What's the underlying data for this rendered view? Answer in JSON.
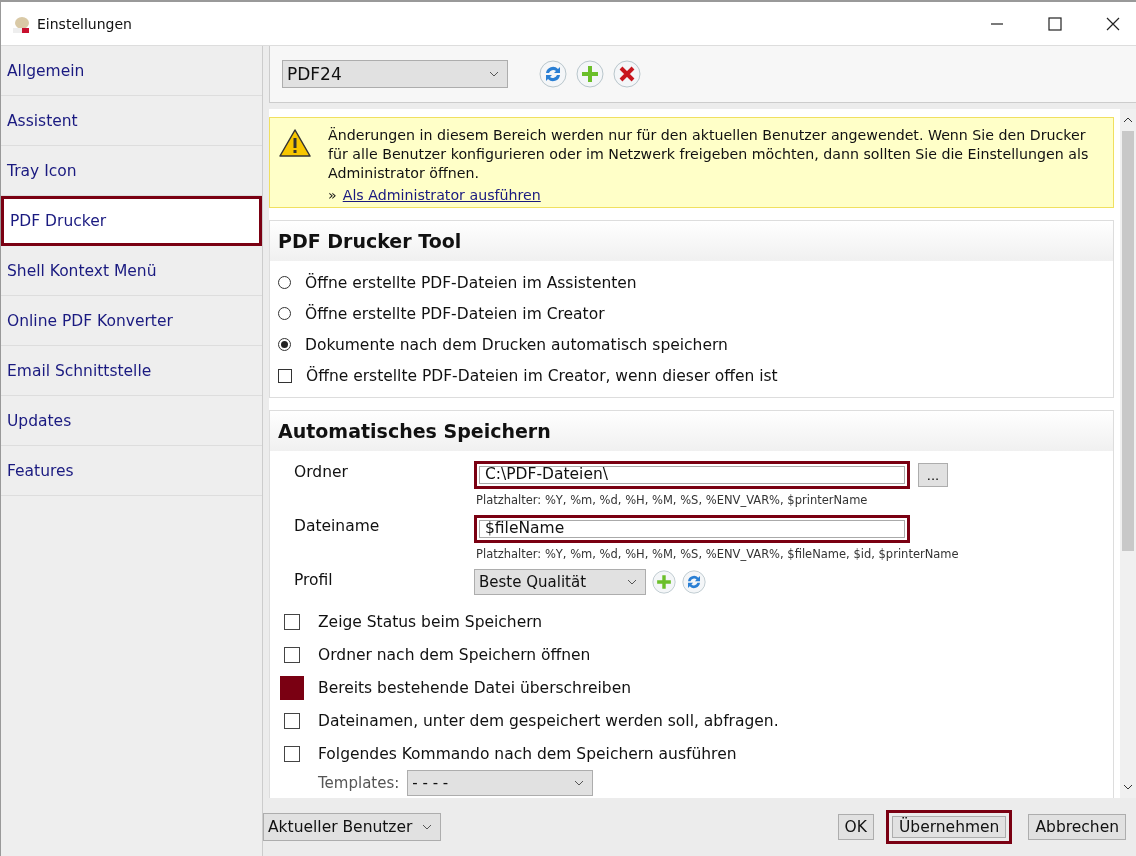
{
  "window": {
    "title": "Einstellungen"
  },
  "sidebar": {
    "items": [
      {
        "label": "Allgemein",
        "selected": false,
        "highlighted": false
      },
      {
        "label": "Assistent",
        "selected": false,
        "highlighted": false
      },
      {
        "label": "Tray Icon",
        "selected": false,
        "highlighted": false
      },
      {
        "label": "PDF Drucker",
        "selected": true,
        "highlighted": true
      },
      {
        "label": "Shell Kontext Menü",
        "selected": false,
        "highlighted": false
      },
      {
        "label": "Online PDF Konverter",
        "selected": false,
        "highlighted": false
      },
      {
        "label": "Email Schnittstelle",
        "selected": false,
        "highlighted": false
      },
      {
        "label": "Updates",
        "selected": false,
        "highlighted": false
      },
      {
        "label": "Features",
        "selected": false,
        "highlighted": false
      }
    ]
  },
  "toolbar": {
    "printer": "PDF24"
  },
  "notice": {
    "text": "Änderungen in diesem Bereich werden nur für den aktuellen Benutzer angewendet. Wenn Sie den Drucker für alle Benutzer konfigurieren oder im Netzwerk freigeben möchten, dann sollten Sie die Einstellungen als Administrator öffnen.",
    "link_prefix": "»",
    "link": "Als Administrator ausführen"
  },
  "printer_tool": {
    "title": "PDF Drucker Tool",
    "options": [
      {
        "kind": "radio",
        "label": "Öffne erstellte PDF-Dateien im Assistenten",
        "selected": false
      },
      {
        "kind": "radio",
        "label": "Öffne erstellte PDF-Dateien im Creator",
        "selected": false
      },
      {
        "kind": "radio",
        "label": "Dokumente nach dem Drucken automatisch speichern",
        "selected": true
      },
      {
        "kind": "checkbox",
        "label": "Öffne erstellte PDF-Dateien im Creator, wenn dieser offen ist",
        "checked": false
      }
    ]
  },
  "autosave": {
    "title": "Automatisches Speichern",
    "fields": [
      {
        "label": "Ordner",
        "value": "C:\\PDF-Dateien\\",
        "hint": "Platzhalter: %Y, %m, %d, %H, %M, %S, %ENV_VAR%, $printerName",
        "highlighted": true,
        "browse": "..."
      },
      {
        "label": "Dateiname",
        "value": "$fileName",
        "hint": "Platzhalter: %Y, %m, %d, %H, %M, %S, %ENV_VAR%, $fileName, $id, $printerName",
        "highlighted": true
      }
    ],
    "profile": {
      "label": "Profil",
      "value": "Beste Qualität"
    },
    "options": [
      {
        "label": "Zeige Status beim Speichern",
        "checked": false,
        "highlighted": false
      },
      {
        "label": "Ordner nach dem Speichern öffnen",
        "checked": false,
        "highlighted": false
      },
      {
        "label": "Bereits bestehende Datei überschreiben",
        "checked": true,
        "highlighted": true
      },
      {
        "label": "Dateinamen, unter dem gespeichert werden soll, abfragen.",
        "checked": false,
        "highlighted": false
      },
      {
        "label": "Folgendes Kommando nach dem Speichern ausführen",
        "checked": false,
        "highlighted": false
      }
    ],
    "templates": {
      "label": "Templates:",
      "value": "- - - -"
    }
  },
  "footer": {
    "scope": "Aktueller Benutzer",
    "buttons": [
      {
        "label": "OK",
        "highlighted": false
      },
      {
        "label": "Übernehmen",
        "highlighted": true
      },
      {
        "label": "Abbrechen",
        "highlighted": false
      }
    ]
  }
}
